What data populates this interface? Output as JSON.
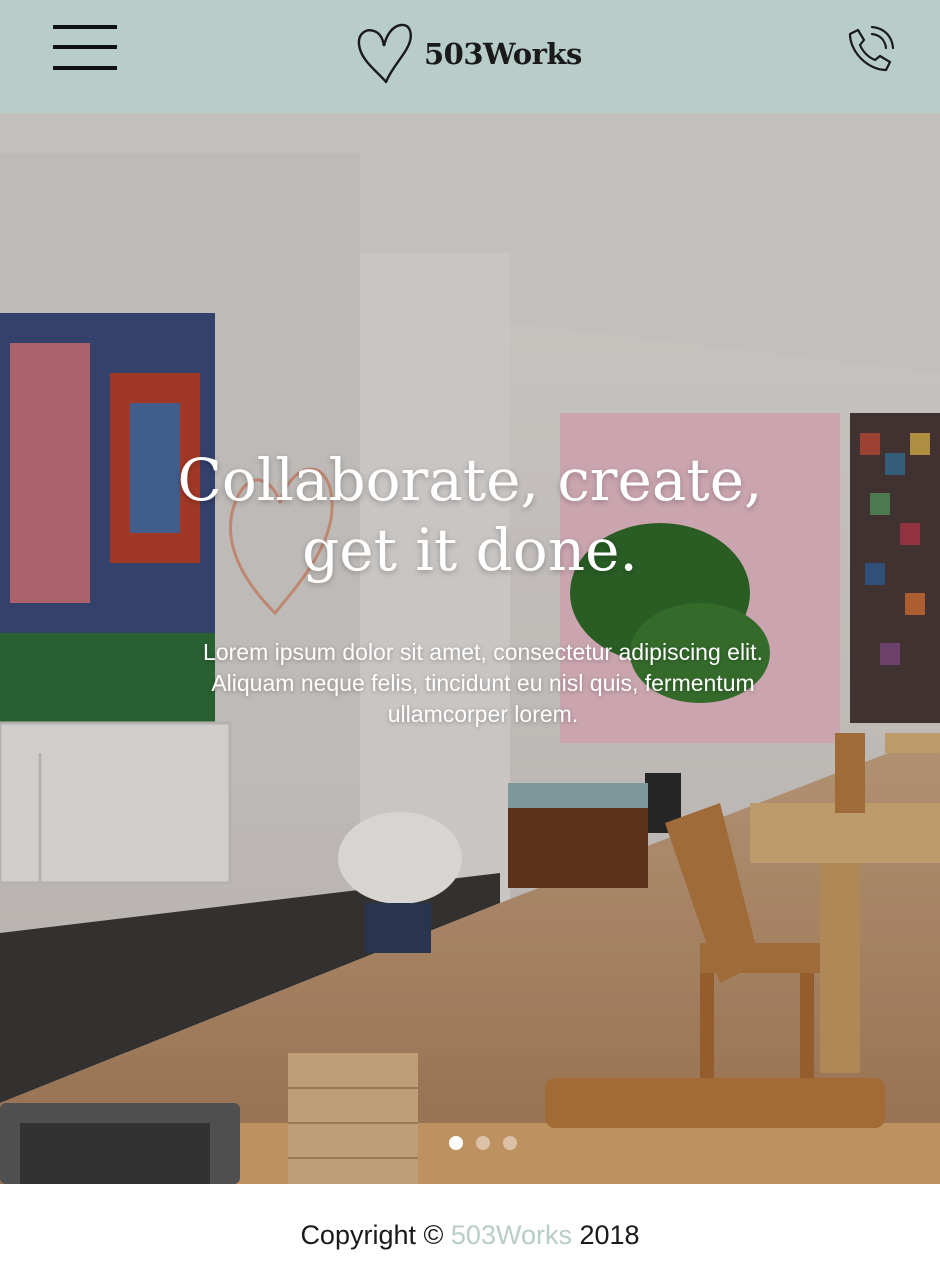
{
  "header": {
    "menu_icon": "hamburger-menu-icon",
    "logo_icon": "heart-icon",
    "logo_text": "503Works",
    "phone_icon": "phone-icon",
    "background_color": "#b8ccc9"
  },
  "hero": {
    "title_line1": "Collaborate, create,",
    "title_line2": "get it done.",
    "body": "Lorem ipsum dolor sit amet, consectetur adipiscing elit. Aliquam neque felis, tincidunt eu nisl quis, fermentum ullamcorper lorem.",
    "slides": 3,
    "active_slide": 1
  },
  "footer": {
    "prefix": "Copyright ©",
    "brand": "503Works",
    "year": "2018",
    "brand_color": "#b8ccc9"
  }
}
